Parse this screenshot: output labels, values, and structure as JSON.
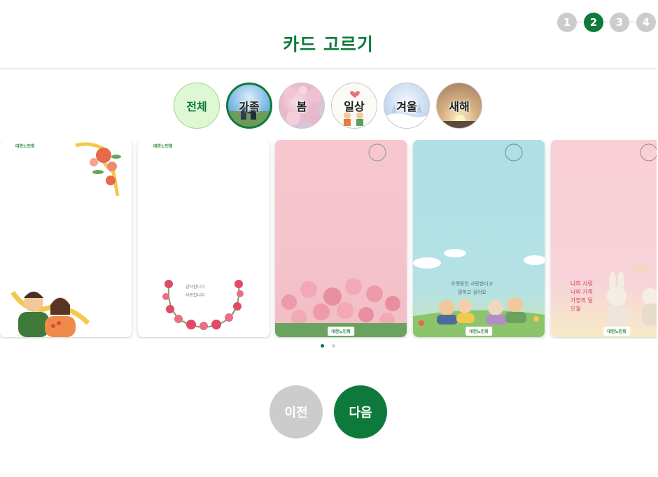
{
  "steps": [
    "1",
    "2",
    "3",
    "4"
  ],
  "active_step": "2",
  "header": {
    "title": "카드 고르기"
  },
  "categories": [
    {
      "label": "전체"
    },
    {
      "label": "가족"
    },
    {
      "label": "봄"
    },
    {
      "label": "일상"
    },
    {
      "label": "겨울"
    },
    {
      "label": "새해"
    }
  ],
  "selected_category": "가족",
  "cards": [
    {
      "brand": "대한노인회"
    },
    {
      "brand": "대한노인회",
      "message": [
        "감사합니다",
        "사랑합니다"
      ]
    },
    {
      "brand": "대한노인회"
    },
    {
      "brand": "대한노인회",
      "message": [
        "오랫동안 사랑한다고",
        "말하고 싶어요"
      ]
    },
    {
      "brand": "대한노인회",
      "message": [
        "나의 사랑",
        "나의 가족",
        "가정의 달",
        "오월"
      ]
    }
  ],
  "pagination": {
    "total": 2,
    "current": 1
  },
  "buttons": {
    "prev_label": "이전",
    "next_label": "다음"
  },
  "colors": {
    "primary": "#0d7a3c",
    "inactive": "#cccccc",
    "all_chip": "#ddf8d2"
  }
}
